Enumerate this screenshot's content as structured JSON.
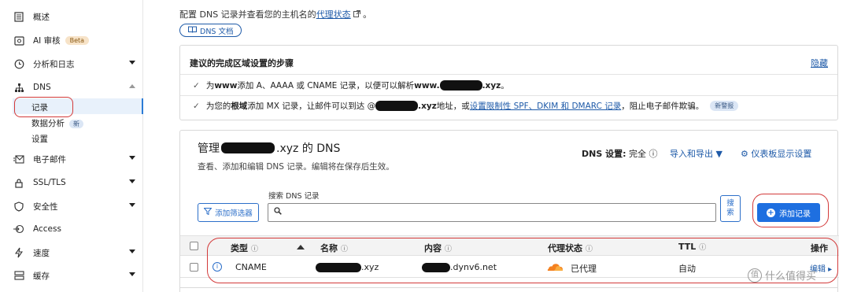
{
  "sidebar": {
    "items": [
      {
        "label": "概述",
        "icon": "document-icon"
      },
      {
        "label": "AI 审核",
        "icon": "ai-audit-icon",
        "badge": "Beta"
      },
      {
        "label": "分析和日志",
        "icon": "clock-icon"
      },
      {
        "label": "DNS",
        "icon": "sitemap-icon"
      },
      {
        "label": "电子邮件",
        "icon": "email-icon"
      },
      {
        "label": "SSL/TLS",
        "icon": "lock-icon"
      },
      {
        "label": "安全性",
        "icon": "shield-icon"
      },
      {
        "label": "Access",
        "icon": "access-icon"
      },
      {
        "label": "速度",
        "icon": "lightning-icon"
      },
      {
        "label": "缓存",
        "icon": "cache-icon"
      }
    ],
    "dns_sub": [
      {
        "label": "记录"
      },
      {
        "label": "数据分析",
        "badge": "新"
      },
      {
        "label": "设置"
      }
    ]
  },
  "intro": {
    "text": "配置 DNS 记录并查看您的主机名的",
    "link": "代理状态",
    "after": "。",
    "docs_button": "DNS 文档"
  },
  "setup_card": {
    "title": "建议的完成区域设置的步骤",
    "hide": "隐藏",
    "step1": {
      "a": "为 ",
      "b": "www",
      "c": " 添加 A、AAAA 或 CNAME 记录，以便可以解析 ",
      "d": "www.",
      "e": ".xyz",
      "f": "。"
    },
    "step2": {
      "a": "为您的",
      "b": "根域",
      "c": "添加 MX 记录，让邮件可以到达 @",
      "d": ".xyz",
      "e": " 地址，或",
      "link": "设置限制性 SPF、DKIM 和 DMARC 记录",
      "f": "，阻止电子邮件欺骗。",
      "badge": "新警报"
    }
  },
  "manage": {
    "title_prefix": "管理 ",
    "title_suffix": ".xyz 的 DNS",
    "subtitle": "查看、添加和编辑 DNS 记录。编辑将在保存后生效。",
    "dns_setting_label": "DNS 设置:",
    "dns_setting_value": "完全",
    "import_export": "导入和导出",
    "dashboard_settings": "仪表板显示设置",
    "search_label": "搜索 DNS 记录",
    "filter_button": "添加筛选器",
    "search_placeholder": "",
    "search_button_1": "搜",
    "search_button_2": "索",
    "add_button": "添加记录"
  },
  "table": {
    "headers": {
      "type": "类型",
      "name": "名称",
      "content": "内容",
      "proxy": "代理状态",
      "ttl": "TTL",
      "actions": "操作"
    },
    "rows": [
      {
        "type": "CNAME",
        "name_suffix": ".xyz",
        "content_suffix": ".dynv6.net",
        "proxy": "已代理",
        "ttl": "自动",
        "edit": "编辑"
      }
    ]
  },
  "watermark": {
    "text": "什么值得买",
    "symbol": "值"
  }
}
